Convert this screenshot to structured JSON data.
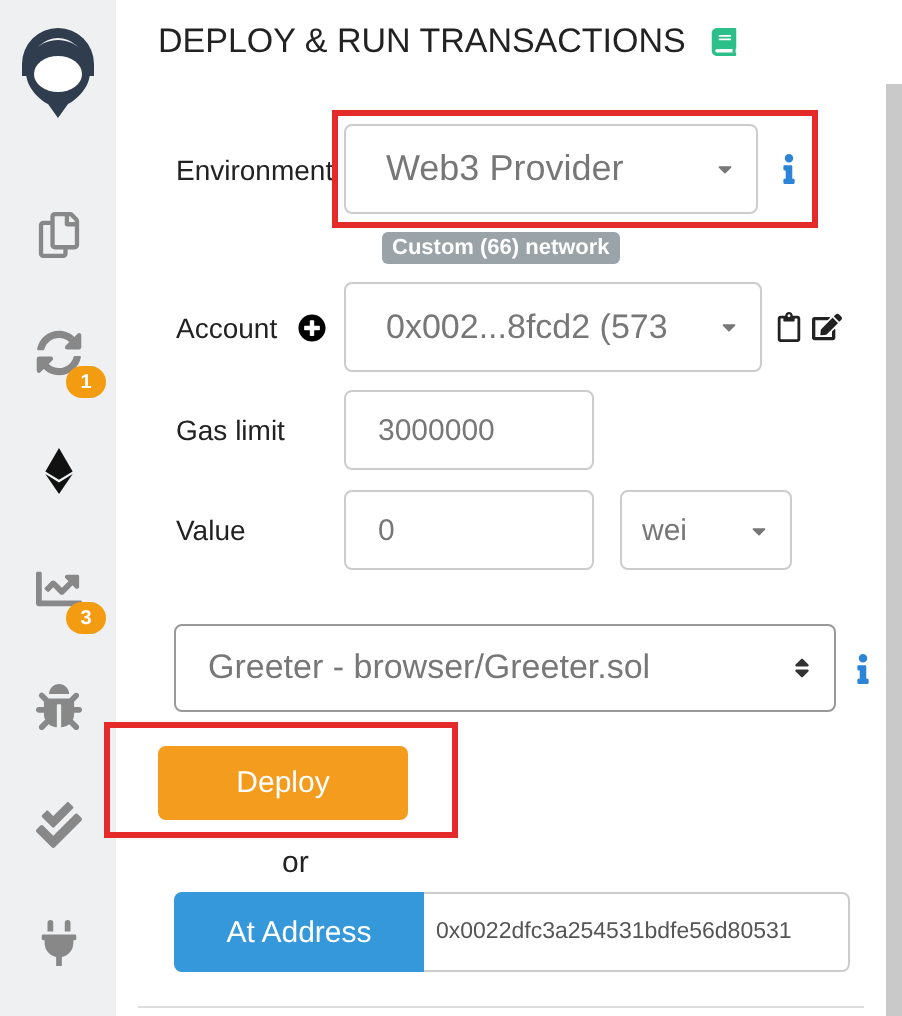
{
  "sidebar": {
    "items": [
      {
        "kind": "files",
        "selected": false
      },
      {
        "kind": "compile",
        "selected": false,
        "badge": "1"
      },
      {
        "kind": "deploy",
        "selected": true
      },
      {
        "kind": "analysis",
        "selected": false,
        "badge": "3"
      },
      {
        "kind": "debug",
        "selected": false
      },
      {
        "kind": "tests",
        "selected": false
      },
      {
        "kind": "plugins",
        "selected": false
      }
    ]
  },
  "title": "DEPLOY & RUN TRANSACTIONS",
  "environment": {
    "label": "Environment",
    "value": "Web3 Provider",
    "network": "Custom (66) network",
    "highlighted": true
  },
  "account": {
    "label": "Account",
    "value": "0x002...8fcd2 (573"
  },
  "gas_limit": {
    "label": "Gas limit",
    "value": "3000000"
  },
  "value": {
    "label": "Value",
    "value": "0",
    "unit": "wei"
  },
  "contract": {
    "value": "Greeter - browser/Greeter.sol"
  },
  "deploy": {
    "label": "Deploy",
    "highlighted": true
  },
  "or": "or",
  "at_address": {
    "label": "At Address",
    "value": "0x0022dfc3a254531bdfe56d80531"
  }
}
